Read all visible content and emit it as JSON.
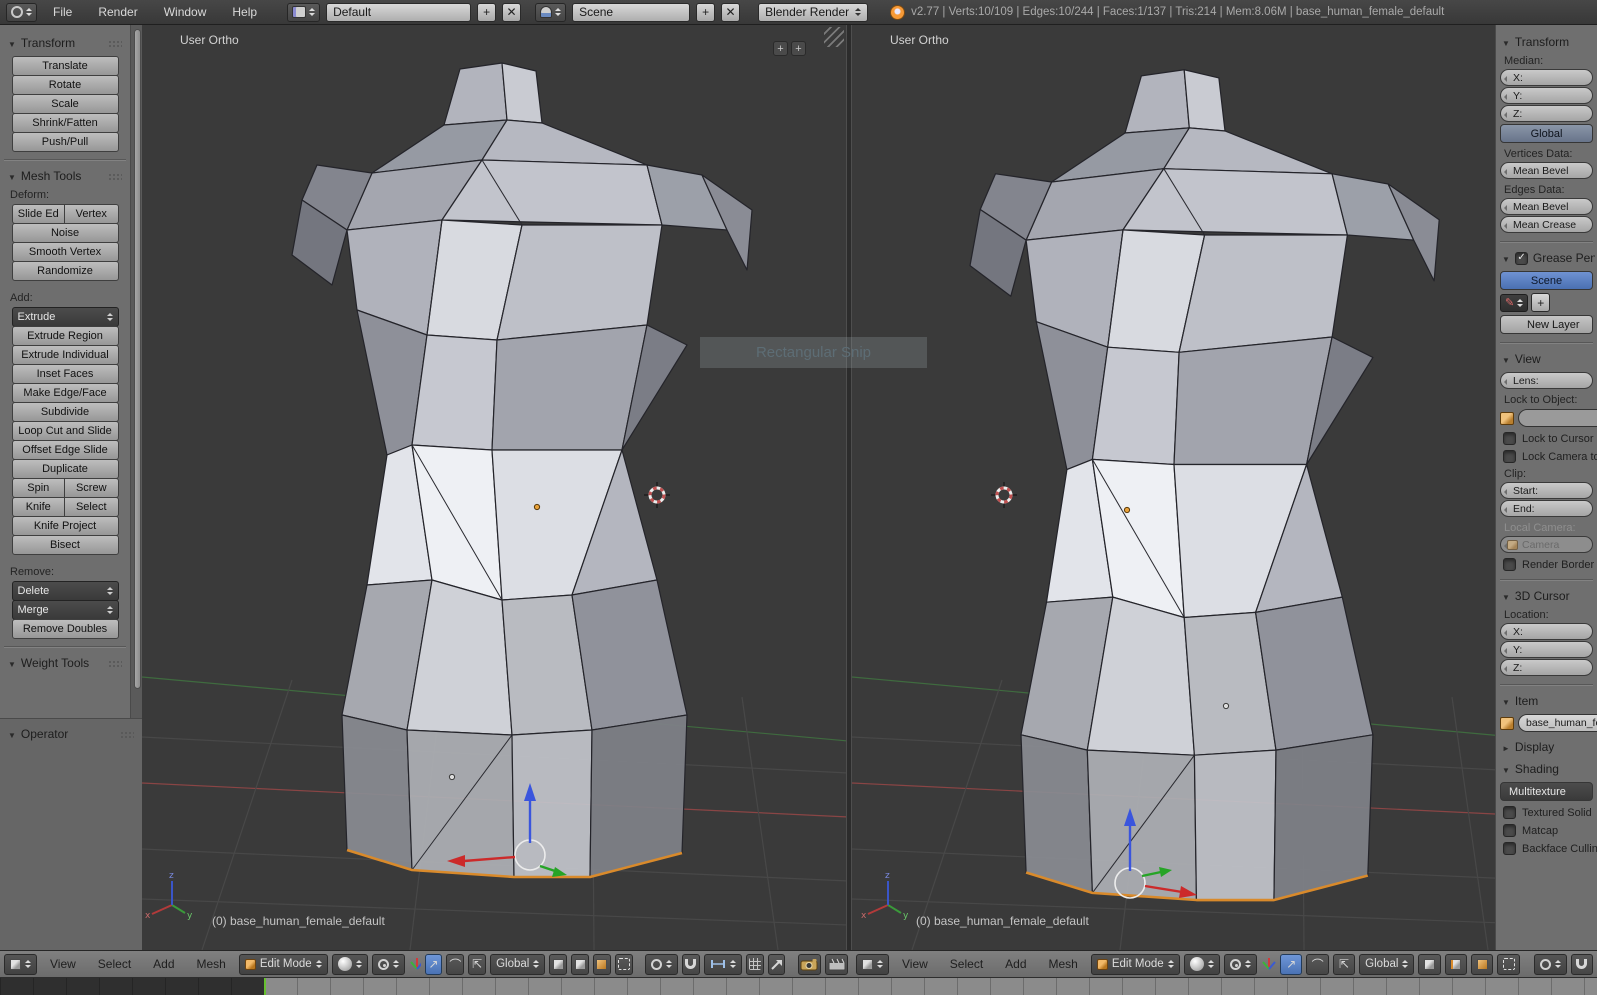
{
  "topbar": {
    "menus": [
      "File",
      "Render",
      "Window",
      "Help"
    ],
    "layout_name": "Default",
    "scene_name": "Scene",
    "render_engine": "Blender Render",
    "stats": "v2.77 | Verts:10/109 | Edges:10/244 | Faces:1/137 | Tris:214 | Mem:8.06M | base_human_female_default"
  },
  "tool_shelf": {
    "transform": {
      "title": "Transform",
      "buttons": [
        "Translate",
        "Rotate",
        "Scale",
        "Shrink/Fatten",
        "Push/Pull"
      ]
    },
    "mesh_tools": {
      "title": "Mesh Tools",
      "deform_label": "Deform:",
      "slide_edge": "Slide Ed",
      "vertex": "Vertex",
      "deform_buttons": [
        "Noise",
        "Smooth Vertex",
        "Randomize"
      ],
      "add_label": "Add:",
      "extrude": "Extrude",
      "add_buttons": [
        "Extrude Region",
        "Extrude Individual",
        "Inset Faces",
        "Make Edge/Face",
        "Subdivide",
        "Loop Cut and Slide",
        "Offset Edge Slide",
        "Duplicate"
      ],
      "spin": "Spin",
      "screw": "Screw",
      "knife": "Knife",
      "select": "Select",
      "knife_project": "Knife Project",
      "bisect": "Bisect",
      "remove_label": "Remove:",
      "delete": "Delete",
      "merge": "Merge",
      "remove_doubles": "Remove Doubles"
    },
    "weight_tools_title": "Weight Tools",
    "operator_title": "Operator"
  },
  "viewport": {
    "view_label": "User Ortho",
    "object_label": "(0) base_human_female_default"
  },
  "snip_overlay_label": "Rectangular Snip",
  "header": {
    "menus": [
      "View",
      "Select",
      "Add",
      "Mesh"
    ],
    "mode": "Edit Mode",
    "orientation": "Global"
  },
  "properties": {
    "transform": {
      "title": "Transform",
      "median_label": "Median:",
      "x": "X:",
      "y": "Y:",
      "z": "Z:",
      "global_btn": "Global",
      "vertices_data_label": "Vertices Data:",
      "mean_bevel": "Mean Bevel",
      "edges_data_label": "Edges Data:",
      "mean_bevel2": "Mean Bevel",
      "mean_crease": "Mean Crease"
    },
    "grease": {
      "title": "Grease Pencil",
      "scene_btn": "Scene",
      "new_btn": "New Layer"
    },
    "view": {
      "title": "View",
      "lens": "Lens:",
      "lock_to_object": "Lock to Object:",
      "lock_to_cursor": "Lock to Cursor",
      "lock_camera": "Lock Camera to View",
      "clip_label": "Clip:",
      "start": "Start:",
      "end": "End:",
      "local_camera_label": "Local Camera:",
      "camera": "Camera",
      "render_border": "Render Border"
    },
    "cursor": {
      "title": "3D Cursor",
      "location_label": "Location:",
      "x": "X:",
      "y": "Y:",
      "z": "Z:"
    },
    "item": {
      "title": "Item",
      "name": "base_human_female_default"
    },
    "display_title": "Display",
    "shading": {
      "title": "Shading",
      "mode": "Multitexture",
      "textured_solid": "Textured Solid",
      "matcap": "Matcap",
      "backface": "Backface Culling"
    }
  },
  "colors": {
    "accent_blue": "#4a72b4",
    "selection_orange": "#d98a2b",
    "playhead_green": "#67c030"
  }
}
